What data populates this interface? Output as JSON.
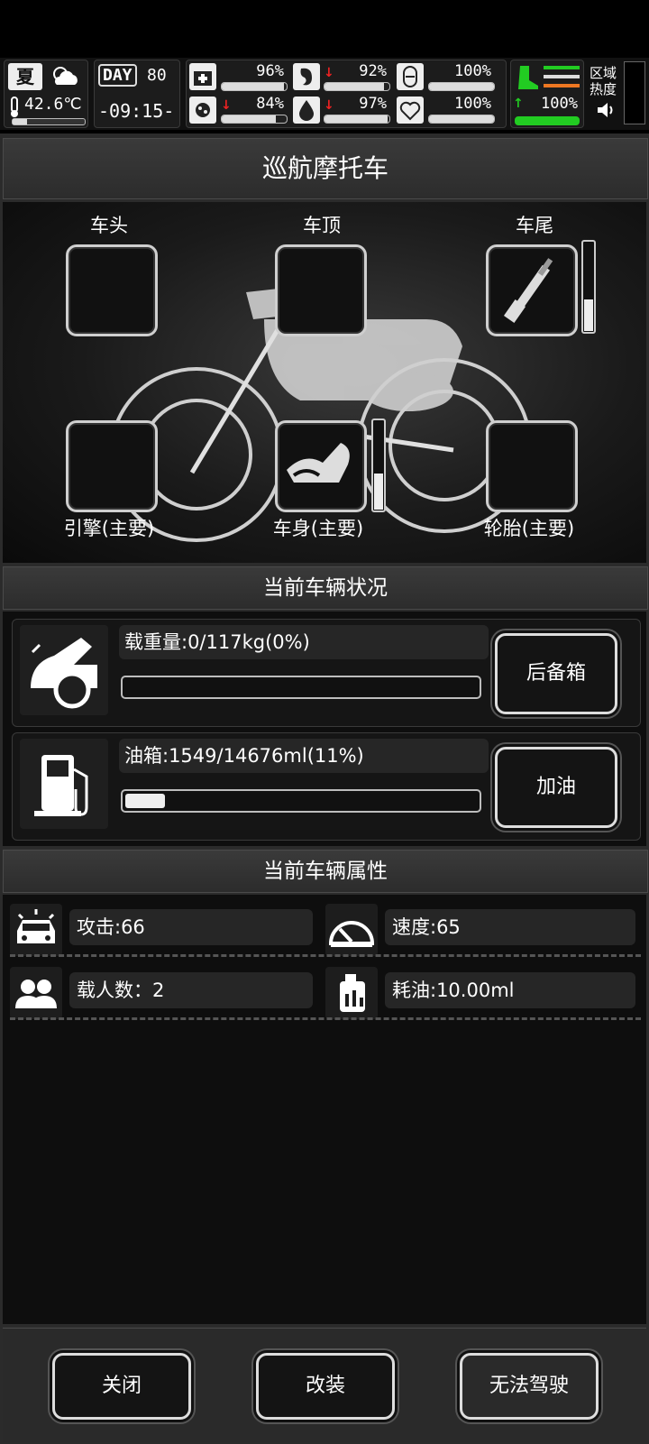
{
  "hud": {
    "season": "夏",
    "temperature": "42.6℃",
    "day_label": "DAY",
    "day_number": "80",
    "clock": "-09:15-",
    "stats": [
      {
        "name": "health",
        "value": "96%",
        "level": 0.96
      },
      {
        "name": "hunger",
        "value": "92%",
        "level": 0.92
      },
      {
        "name": "mood",
        "value": "100%",
        "level": 1.0
      },
      {
        "name": "infection",
        "value": "84%",
        "level": 0.84
      },
      {
        "name": "thirst",
        "value": "97%",
        "level": 0.97
      },
      {
        "name": "heart",
        "value": "100%",
        "level": 1.0
      }
    ],
    "stamina": "100%",
    "area_heat_label": "区域热度"
  },
  "vehicle": {
    "title": "巡航摩托车",
    "slots": {
      "head": "车头",
      "top": "车顶",
      "tail": "车尾",
      "engine": "引擎(主要)",
      "body": "车身(主要)",
      "tire": "轮胎(主要)"
    },
    "tail_bar_level": 0.35,
    "body_bar_level": 0.4
  },
  "status": {
    "section_title": "当前车辆状况",
    "load_text": "载重量:0/117kg(0%)",
    "load_level": 0.0,
    "trunk_button": "后备箱",
    "fuel_text": "油箱:1549/14676ml(11%)",
    "fuel_level": 0.11,
    "refuel_button": "加油"
  },
  "attributes": {
    "section_title": "当前车辆属性",
    "attack": "攻击:66",
    "speed": "速度:65",
    "passengers": "载人数：2",
    "fuel_use": "耗油:10.00ml"
  },
  "footer": {
    "close": "关闭",
    "modify": "改装",
    "drive": "无法驾驶"
  }
}
